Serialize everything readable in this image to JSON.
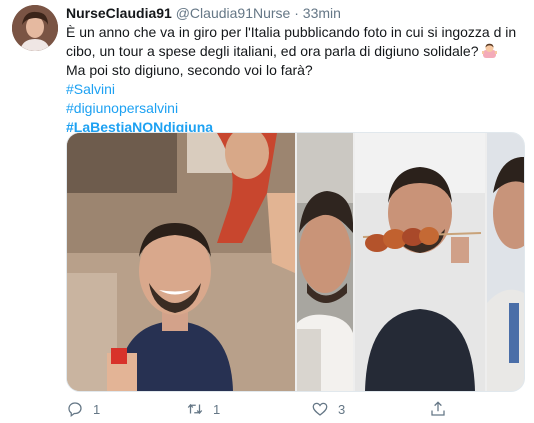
{
  "tweet": {
    "author_name": "NurseClaudia91",
    "author_handle": "@Claudia91Nurse",
    "separator": "·",
    "time": "33min",
    "text_lines": [
      "È un anno che va in giro per l'Italia pubblicando foto in cui si ingozza d in",
      "cibo, un tour a spese degli italiani, ed ora parla di digiuno solidale?",
      "Ma poi sto digiuno, secondo voi lo farà?"
    ],
    "emoji": "woman-shrugging-emoji",
    "hashtags": [
      "#Salvini",
      "#digiunopersalvini",
      "#LaBestiaNONdigiuna"
    ]
  },
  "actions": {
    "reply_count": "1",
    "retweet_count": "1",
    "like_count": "3",
    "share_count": ""
  },
  "colors": {
    "link": "#1da1f2",
    "muted": "#657786",
    "text": "#14171a"
  }
}
